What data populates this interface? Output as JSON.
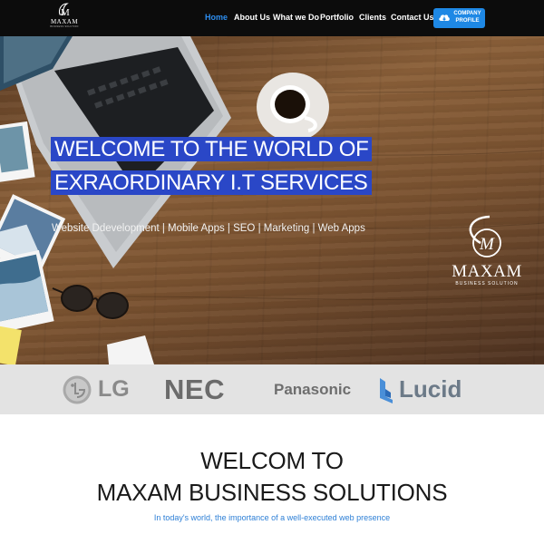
{
  "nav": {
    "logo_text": "MAXAM",
    "logo_sub": "BUSINESS SOLUTION",
    "items": [
      {
        "label": "Home",
        "active": true
      },
      {
        "label": "About Us",
        "active": false
      },
      {
        "label": "What we Do",
        "active": false
      },
      {
        "label": "Portfolio",
        "active": false
      },
      {
        "label": "Clients",
        "active": false
      },
      {
        "label": "Contact Us",
        "active": false
      }
    ],
    "profile_button": {
      "line1": "COMPANY",
      "line2": "PROFILE",
      "icon": "cloud-download-icon"
    }
  },
  "hero": {
    "title_line1": "WELCOME TO THE WORLD OF",
    "title_line2": "EXRAORDINARY I.T SERVICES",
    "subtitle": "Website Ddevelopment | Mobile Apps | SEO | Marketing | Web Apps",
    "logo_name": "MAXAM",
    "logo_sub": "BUSINESS SOLUTION",
    "highlight_color": "#2a47c7"
  },
  "partners": [
    {
      "name": "LG"
    },
    {
      "name": "NEC"
    },
    {
      "name": "Panasonic"
    },
    {
      "name": "Lucid"
    }
  ],
  "welcome": {
    "line1": "WELCOM TO",
    "line2": "MAXAM BUSINESS SOLUTIONS",
    "tagline": "In today's world, the importance of a well-executed web presence"
  },
  "colors": {
    "nav_bg": "#0c0c0c",
    "accent": "#1e88e5",
    "active_link": "#2d8ef0"
  }
}
